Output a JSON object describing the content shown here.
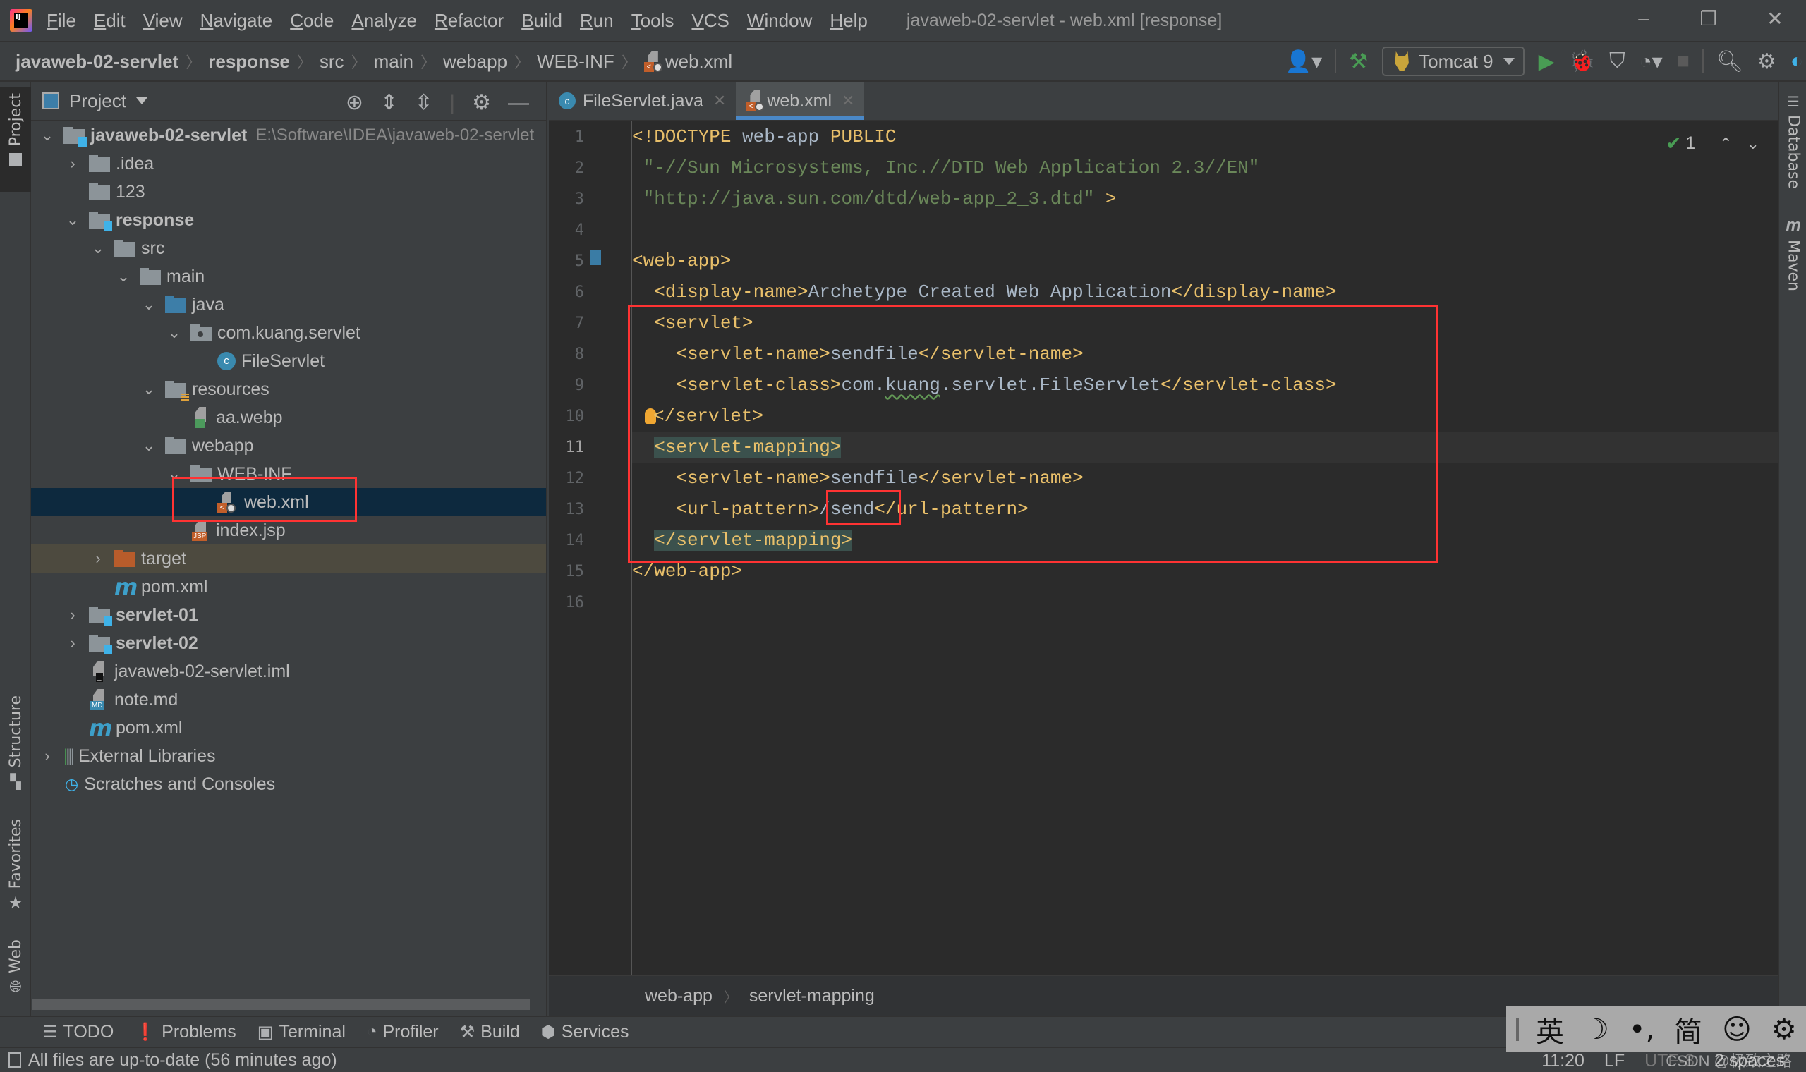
{
  "menubar": {
    "items": [
      "File",
      "Edit",
      "View",
      "Navigate",
      "Code",
      "Analyze",
      "Refactor",
      "Build",
      "Run",
      "Tools",
      "VCS",
      "Window",
      "Help"
    ],
    "window_title": "javaweb-02-servlet - web.xml [response]",
    "minimize": "–",
    "restore": "❐",
    "close": "✕"
  },
  "navbar": {
    "crumbs": [
      "javaweb-02-servlet",
      "response",
      "src",
      "main",
      "webapp",
      "WEB-INF",
      "web.xml"
    ],
    "run_config": "Tomcat 9"
  },
  "left_strip": {
    "project": "Project",
    "structure": "Structure",
    "favorites": "Favorites",
    "web": "Web"
  },
  "right_strip": {
    "database": "Database",
    "maven": "Maven"
  },
  "project_panel": {
    "title": "Project",
    "root_path": "E:\\Software\\IDEA\\javaweb-02-servlet",
    "tree": [
      {
        "label": "javaweb-02-servlet",
        "bold": true,
        "expanded": true
      },
      {
        "label": ".idea"
      },
      {
        "label": "123"
      },
      {
        "label": "response",
        "bold": true
      },
      {
        "label": "src"
      },
      {
        "label": "main"
      },
      {
        "label": "java"
      },
      {
        "label": "com.kuang.servlet"
      },
      {
        "label": "FileServlet"
      },
      {
        "label": "resources"
      },
      {
        "label": "aa.webp"
      },
      {
        "label": "webapp"
      },
      {
        "label": "WEB-INF"
      },
      {
        "label": "web.xml",
        "selected": true
      },
      {
        "label": "index.jsp"
      },
      {
        "label": "target"
      },
      {
        "label": "pom.xml"
      },
      {
        "label": "servlet-01",
        "bold": true
      },
      {
        "label": "servlet-02",
        "bold": true
      },
      {
        "label": "javaweb-02-servlet.iml"
      },
      {
        "label": "note.md"
      },
      {
        "label": "pom.xml"
      },
      {
        "label": "External Libraries"
      },
      {
        "label": "Scratches and Consoles"
      }
    ]
  },
  "editor": {
    "tabs": [
      {
        "label": "FileServlet.java",
        "active": false
      },
      {
        "label": "web.xml",
        "active": true
      }
    ],
    "line_numbers": [
      "1",
      "2",
      "3",
      "4",
      "5",
      "6",
      "7",
      "8",
      "9",
      "10",
      "11",
      "12",
      "13",
      "14",
      "15",
      "16"
    ],
    "current_line": "11",
    "code": {
      "l1": [
        "<!DOCTYPE",
        " web-app ",
        "PUBLIC"
      ],
      "l2": " \"-//Sun Microsystems, Inc.//DTD Web Application 2.3//EN\"",
      "l3": [
        " \"http://java.sun.com/dtd/web-app_2_3.dtd\"",
        " >"
      ],
      "l5": "<web-app>",
      "l6": [
        "  <display-name>",
        "Archetype Created Web Application",
        "</display-name>"
      ],
      "l7": "  <servlet>",
      "l8": [
        "    <servlet-name>",
        "sendfile",
        "</servlet-name>"
      ],
      "l9": [
        "    <servlet-class>",
        "com.",
        "kuang",
        ".servlet.FileServlet",
        "</servlet-class>"
      ],
      "l10": "</servlet>",
      "l11": "<servlet-mapping>",
      "l12": [
        "    <servlet-name>",
        "sendfile",
        "</servlet-name>"
      ],
      "l13": [
        "    <url-pattern>",
        "/send",
        "</url-pattern>"
      ],
      "l14": "</servlet-mapping>",
      "l15": "</web-app>"
    },
    "inspection_count": "1",
    "breadcrumbs": [
      "web-app",
      "servlet-mapping"
    ]
  },
  "bottom_tools": [
    "TODO",
    "Problems",
    "Terminal",
    "Profiler",
    "Build",
    "Services"
  ],
  "status_bar": {
    "message": "All files are up-to-date (56 minutes ago)",
    "position": "11:20",
    "line_sep": "LF",
    "encoding": "UTF-8",
    "indent": "2 spaces"
  },
  "ime": {
    "items": [
      "英",
      "☽",
      "•,",
      "简",
      "☺",
      "⚙"
    ]
  },
  "watermark": "CSDN @极致之路"
}
